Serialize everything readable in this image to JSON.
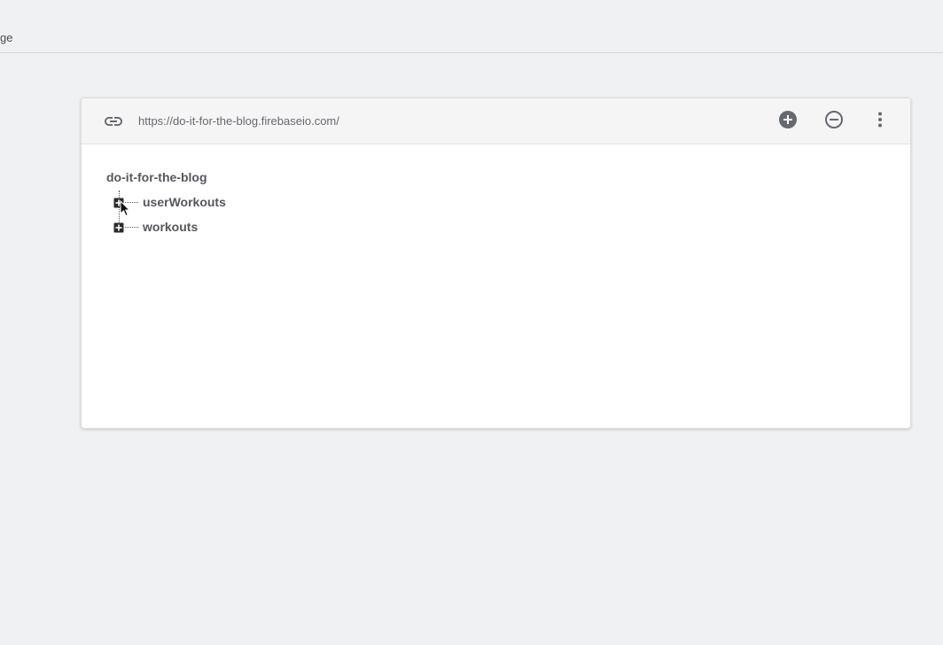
{
  "top_bar": {
    "partial_text": "ge"
  },
  "panel": {
    "url": "https://do-it-for-the-blog.firebaseio.com/",
    "icons": {
      "link": "link-icon",
      "add": "add-circle-icon",
      "remove": "remove-circle-icon",
      "more": "more-vert-icon"
    },
    "tree": {
      "root": "do-it-for-the-blog",
      "children": [
        {
          "key": "userWorkouts",
          "expanded": false
        },
        {
          "key": "workouts",
          "expanded": false
        }
      ]
    }
  },
  "colors": {
    "background": "#f0f1f3",
    "header_bg": "#f5f5f6",
    "icon": "#66696e",
    "text": "#55585c"
  }
}
